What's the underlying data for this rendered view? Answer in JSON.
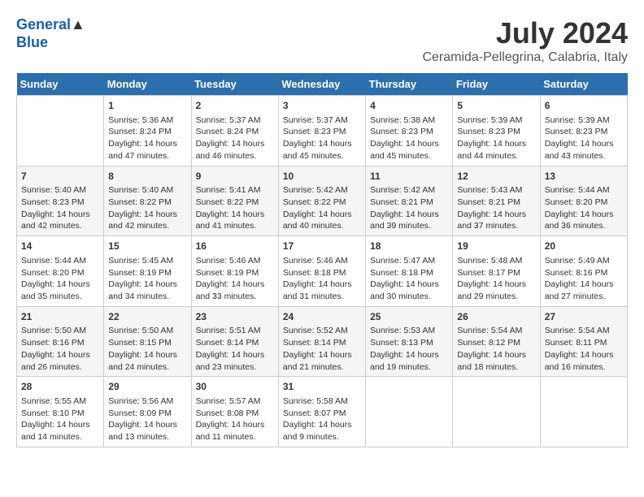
{
  "header": {
    "logo_line1": "General",
    "logo_line2": "Blue",
    "month_year": "July 2024",
    "location": "Ceramida-Pellegrina, Calabria, Italy"
  },
  "days_of_week": [
    "Sunday",
    "Monday",
    "Tuesday",
    "Wednesday",
    "Thursday",
    "Friday",
    "Saturday"
  ],
  "weeks": [
    [
      {
        "day": "",
        "data": ""
      },
      {
        "day": "1",
        "data": "Sunrise: 5:36 AM\nSunset: 8:24 PM\nDaylight: 14 hours\nand 47 minutes."
      },
      {
        "day": "2",
        "data": "Sunrise: 5:37 AM\nSunset: 8:24 PM\nDaylight: 14 hours\nand 46 minutes."
      },
      {
        "day": "3",
        "data": "Sunrise: 5:37 AM\nSunset: 8:23 PM\nDaylight: 14 hours\nand 45 minutes."
      },
      {
        "day": "4",
        "data": "Sunrise: 5:38 AM\nSunset: 8:23 PM\nDaylight: 14 hours\nand 45 minutes."
      },
      {
        "day": "5",
        "data": "Sunrise: 5:39 AM\nSunset: 8:23 PM\nDaylight: 14 hours\nand 44 minutes."
      },
      {
        "day": "6",
        "data": "Sunrise: 5:39 AM\nSunset: 8:23 PM\nDaylight: 14 hours\nand 43 minutes."
      }
    ],
    [
      {
        "day": "7",
        "data": "Sunrise: 5:40 AM\nSunset: 8:23 PM\nDaylight: 14 hours\nand 42 minutes."
      },
      {
        "day": "8",
        "data": "Sunrise: 5:40 AM\nSunset: 8:22 PM\nDaylight: 14 hours\nand 42 minutes."
      },
      {
        "day": "9",
        "data": "Sunrise: 5:41 AM\nSunset: 8:22 PM\nDaylight: 14 hours\nand 41 minutes."
      },
      {
        "day": "10",
        "data": "Sunrise: 5:42 AM\nSunset: 8:22 PM\nDaylight: 14 hours\nand 40 minutes."
      },
      {
        "day": "11",
        "data": "Sunrise: 5:42 AM\nSunset: 8:21 PM\nDaylight: 14 hours\nand 39 minutes."
      },
      {
        "day": "12",
        "data": "Sunrise: 5:43 AM\nSunset: 8:21 PM\nDaylight: 14 hours\nand 37 minutes."
      },
      {
        "day": "13",
        "data": "Sunrise: 5:44 AM\nSunset: 8:20 PM\nDaylight: 14 hours\nand 36 minutes."
      }
    ],
    [
      {
        "day": "14",
        "data": "Sunrise: 5:44 AM\nSunset: 8:20 PM\nDaylight: 14 hours\nand 35 minutes."
      },
      {
        "day": "15",
        "data": "Sunrise: 5:45 AM\nSunset: 8:19 PM\nDaylight: 14 hours\nand 34 minutes."
      },
      {
        "day": "16",
        "data": "Sunrise: 5:46 AM\nSunset: 8:19 PM\nDaylight: 14 hours\nand 33 minutes."
      },
      {
        "day": "17",
        "data": "Sunrise: 5:46 AM\nSunset: 8:18 PM\nDaylight: 14 hours\nand 31 minutes."
      },
      {
        "day": "18",
        "data": "Sunrise: 5:47 AM\nSunset: 8:18 PM\nDaylight: 14 hours\nand 30 minutes."
      },
      {
        "day": "19",
        "data": "Sunrise: 5:48 AM\nSunset: 8:17 PM\nDaylight: 14 hours\nand 29 minutes."
      },
      {
        "day": "20",
        "data": "Sunrise: 5:49 AM\nSunset: 8:16 PM\nDaylight: 14 hours\nand 27 minutes."
      }
    ],
    [
      {
        "day": "21",
        "data": "Sunrise: 5:50 AM\nSunset: 8:16 PM\nDaylight: 14 hours\nand 26 minutes."
      },
      {
        "day": "22",
        "data": "Sunrise: 5:50 AM\nSunset: 8:15 PM\nDaylight: 14 hours\nand 24 minutes."
      },
      {
        "day": "23",
        "data": "Sunrise: 5:51 AM\nSunset: 8:14 PM\nDaylight: 14 hours\nand 23 minutes."
      },
      {
        "day": "24",
        "data": "Sunrise: 5:52 AM\nSunset: 8:14 PM\nDaylight: 14 hours\nand 21 minutes."
      },
      {
        "day": "25",
        "data": "Sunrise: 5:53 AM\nSunset: 8:13 PM\nDaylight: 14 hours\nand 19 minutes."
      },
      {
        "day": "26",
        "data": "Sunrise: 5:54 AM\nSunset: 8:12 PM\nDaylight: 14 hours\nand 18 minutes."
      },
      {
        "day": "27",
        "data": "Sunrise: 5:54 AM\nSunset: 8:11 PM\nDaylight: 14 hours\nand 16 minutes."
      }
    ],
    [
      {
        "day": "28",
        "data": "Sunrise: 5:55 AM\nSunset: 8:10 PM\nDaylight: 14 hours\nand 14 minutes."
      },
      {
        "day": "29",
        "data": "Sunrise: 5:56 AM\nSunset: 8:09 PM\nDaylight: 14 hours\nand 13 minutes."
      },
      {
        "day": "30",
        "data": "Sunrise: 5:57 AM\nSunset: 8:08 PM\nDaylight: 14 hours\nand 11 minutes."
      },
      {
        "day": "31",
        "data": "Sunrise: 5:58 AM\nSunset: 8:07 PM\nDaylight: 14 hours\nand 9 minutes."
      },
      {
        "day": "",
        "data": ""
      },
      {
        "day": "",
        "data": ""
      },
      {
        "day": "",
        "data": ""
      }
    ]
  ]
}
